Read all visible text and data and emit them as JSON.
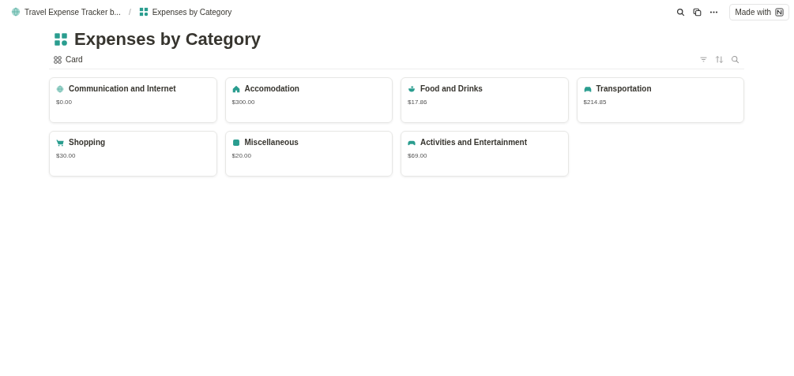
{
  "breadcrumbs": [
    {
      "label": "Travel Expense Tracker b...",
      "kind": "globe"
    },
    {
      "label": "Expenses by Category",
      "kind": "grid"
    }
  ],
  "breadcrumb_separator": "/",
  "topbar": {
    "made_with": "Made with"
  },
  "title": "Expenses by Category",
  "view": {
    "label": "Card"
  },
  "cards": [
    {
      "name": "Communication and Internet",
      "amount": "$0.00",
      "kind": "globe"
    },
    {
      "name": "Accomodation",
      "amount": "$300.00",
      "kind": "house"
    },
    {
      "name": "Food and Drinks",
      "amount": "$17.86",
      "kind": "bowl"
    },
    {
      "name": "Transportation",
      "amount": "$214.85",
      "kind": "car"
    },
    {
      "name": "Shopping",
      "amount": "$30.00",
      "kind": "cart"
    },
    {
      "name": "Miscellaneous",
      "amount": "$20.00",
      "kind": "box"
    },
    {
      "name": "Activities and Entertainment",
      "amount": "$69.00",
      "kind": "gamepad"
    }
  ]
}
